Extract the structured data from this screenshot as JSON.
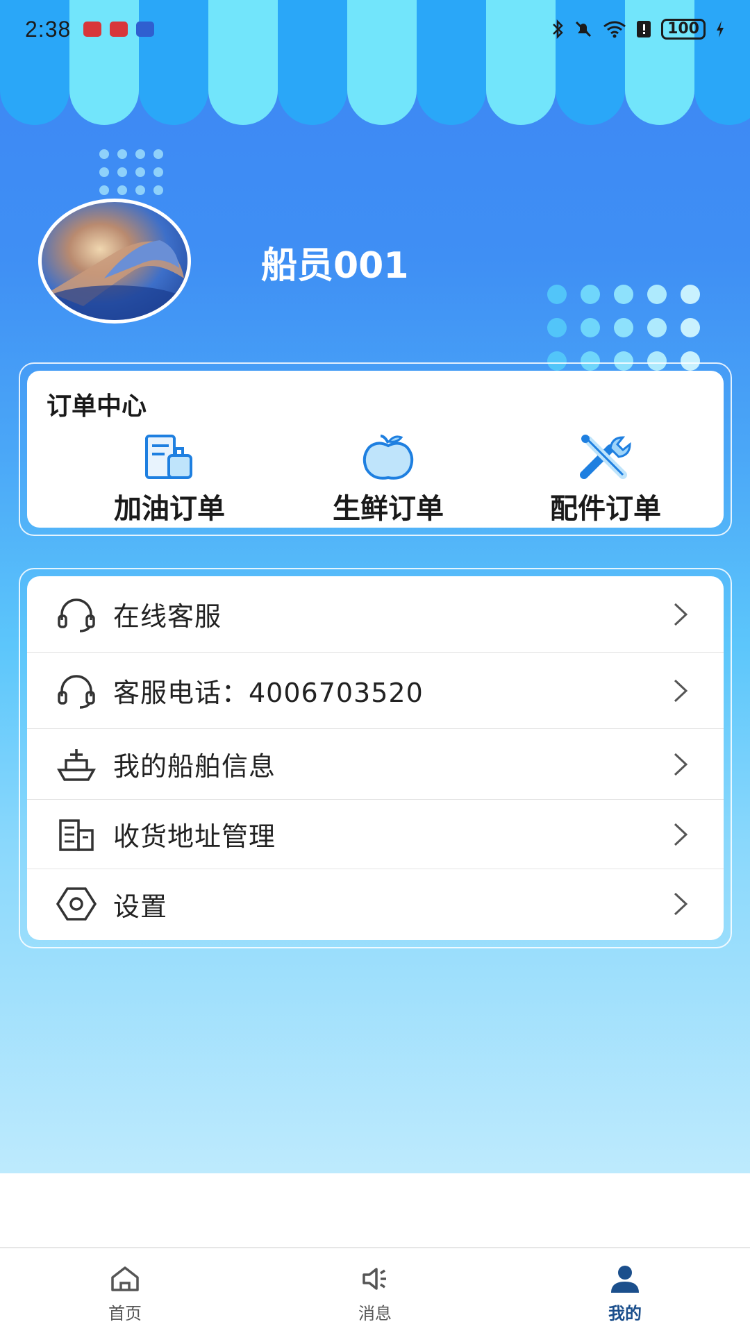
{
  "status_bar": {
    "time": "2:38",
    "battery": "100"
  },
  "profile": {
    "username": "船员001"
  },
  "order_center": {
    "title": "订单中心",
    "items": [
      {
        "label": "加油订单",
        "icon": "fuel-order-icon"
      },
      {
        "label": "生鲜订单",
        "icon": "apple-icon"
      },
      {
        "label": "配件订单",
        "icon": "wrench-screwdriver-icon"
      }
    ]
  },
  "menu": {
    "items": [
      {
        "label": "在线客服",
        "icon": "headset-icon"
      },
      {
        "label": "客服电话：4006703520",
        "icon": "headset-icon"
      },
      {
        "label": "我的船舶信息",
        "icon": "ship-icon"
      },
      {
        "label": "收货地址管理",
        "icon": "building-icon"
      },
      {
        "label": "设置",
        "icon": "hex-nut-settings-icon"
      }
    ]
  },
  "tabbar": {
    "items": [
      {
        "label": "首页",
        "icon": "home-icon"
      },
      {
        "label": "消息",
        "icon": "speaker-icon"
      },
      {
        "label": "我的",
        "icon": "person-icon",
        "active": true
      }
    ]
  },
  "colors": {
    "accent": "#3d86f3",
    "light_cyan": "#72e5fb",
    "active_tab": "#1b4f8c"
  }
}
